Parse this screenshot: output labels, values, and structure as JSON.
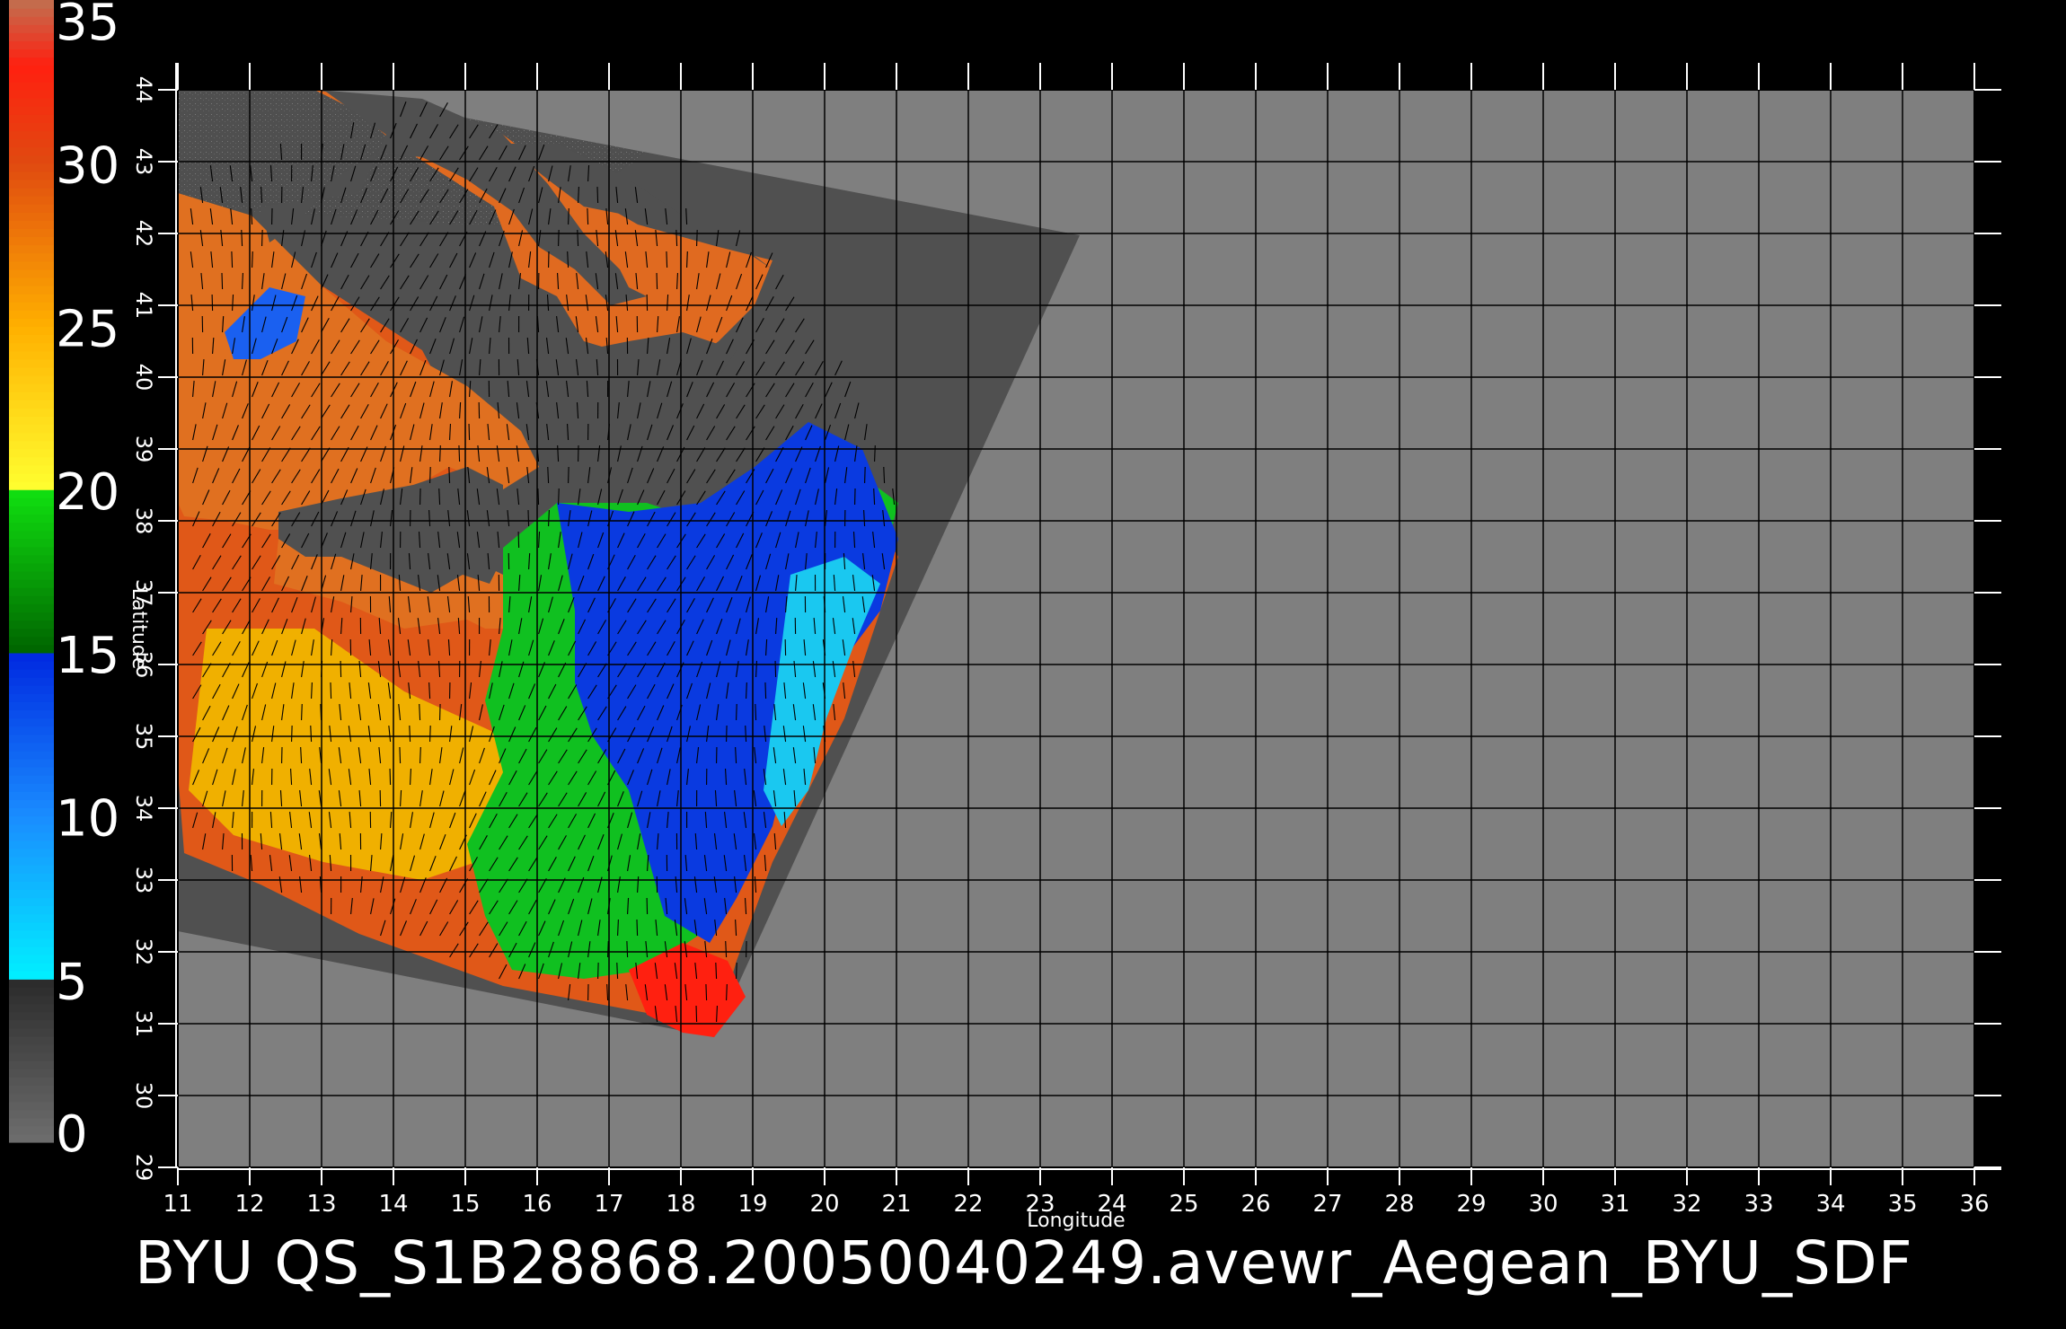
{
  "title": "BYU  QS_S1B28868.20050040249.avewr_Aegean_BYU_SDF",
  "colorbar": {
    "labels": [
      "35",
      "30",
      "25",
      "20",
      "15",
      "10",
      "5",
      "0"
    ],
    "stops": [
      {
        "value": 0,
        "color": "#6e6e6e"
      },
      {
        "value": 5,
        "color": "#2a2a2a"
      },
      {
        "value": 5.01,
        "color": "#00f0ff"
      },
      {
        "value": 10,
        "color": "#1a8cff"
      },
      {
        "value": 15,
        "color": "#0028e0"
      },
      {
        "value": 15.01,
        "color": "#006400"
      },
      {
        "value": 20,
        "color": "#10e010"
      },
      {
        "value": 20.01,
        "color": "#ffff30"
      },
      {
        "value": 25,
        "color": "#ffb000"
      },
      {
        "value": 30,
        "color": "#e04a10"
      },
      {
        "value": 33,
        "color": "#ff2010"
      },
      {
        "value": 35,
        "color": "#c07050"
      }
    ]
  },
  "map": {
    "x_axis_label": "Longitude",
    "y_axis_label": "Latitude",
    "lon_range": [
      11,
      36
    ],
    "lat_range": [
      29,
      44
    ],
    "lon_ticks": [
      "11",
      "12",
      "13",
      "14",
      "15",
      "16",
      "17",
      "18",
      "19",
      "20",
      "21",
      "22",
      "23",
      "24",
      "25",
      "26",
      "27",
      "28",
      "29",
      "30",
      "31",
      "32",
      "33",
      "34",
      "35",
      "36"
    ],
    "lat_ticks": [
      "29",
      "30",
      "31",
      "32",
      "33",
      "34",
      "35",
      "36",
      "37",
      "38",
      "39",
      "40",
      "41",
      "42",
      "43",
      "44"
    ],
    "colors": {
      "background": "#000000",
      "no_data": "#7f7f7f",
      "swath_land": "#505050",
      "grid": "#000000"
    }
  }
}
